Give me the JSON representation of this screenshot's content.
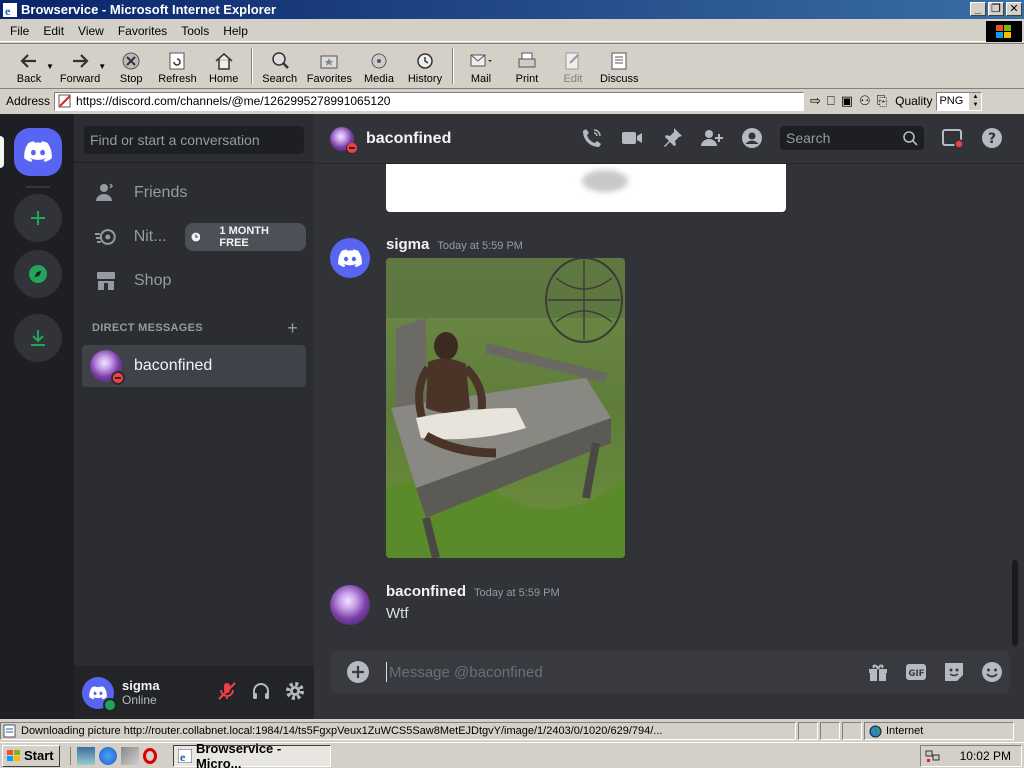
{
  "window": {
    "title": "Browservice - Microsoft Internet Explorer",
    "buttons": [
      "_",
      "❐",
      "✕"
    ]
  },
  "menu": {
    "items": [
      "File",
      "Edit",
      "View",
      "Favorites",
      "Tools",
      "Help"
    ]
  },
  "toolbar": {
    "back": "Back",
    "forward": "Forward",
    "stop": "Stop",
    "refresh": "Refresh",
    "home": "Home",
    "search": "Search",
    "favorites": "Favorites",
    "media": "Media",
    "history": "History",
    "mail": "Mail",
    "print": "Print",
    "edit": "Edit",
    "discuss": "Discuss"
  },
  "address": {
    "label": "Address",
    "url": "https://discord.com/channels/@me/1262995278991065120",
    "quality_label": "Quality",
    "quality_value": "PNG"
  },
  "discord": {
    "dm_search_placeholder": "Find or start a conversation",
    "nav": {
      "friends": "Friends",
      "nitro": "Nit...",
      "nitro_badge": "1 MONTH FREE",
      "shop": "Shop"
    },
    "direct_messages_header": "DIRECT MESSAGES",
    "direct_messages_add": "+",
    "dm_items": [
      {
        "name": "baconfined"
      }
    ],
    "user": {
      "name": "sigma",
      "status": "Online"
    },
    "channel": {
      "name": "baconfined",
      "search_placeholder": "Search"
    },
    "messages": [
      {
        "author": "sigma",
        "time": "Today at 5:59 PM",
        "type": "image"
      },
      {
        "author": "baconfined",
        "time": "Today at 5:59 PM",
        "text": "Wtf"
      }
    ],
    "composer_placeholder": "Message @baconfined"
  },
  "statusbar": {
    "text": "Downloading picture http://router.collabnet.local:1984/14/ts5FgxpVeux1ZuWCS5Saw8MetEJDtgvY/image/1/2403/0/1020/629/794/...",
    "zone": "Internet"
  },
  "taskbar": {
    "start": "Start",
    "task": "Browservice - Micro...",
    "clock": "10:02 PM"
  },
  "colors": {
    "blurple": "#5865f2",
    "dnd": "#f23f43",
    "online": "#23a559"
  }
}
